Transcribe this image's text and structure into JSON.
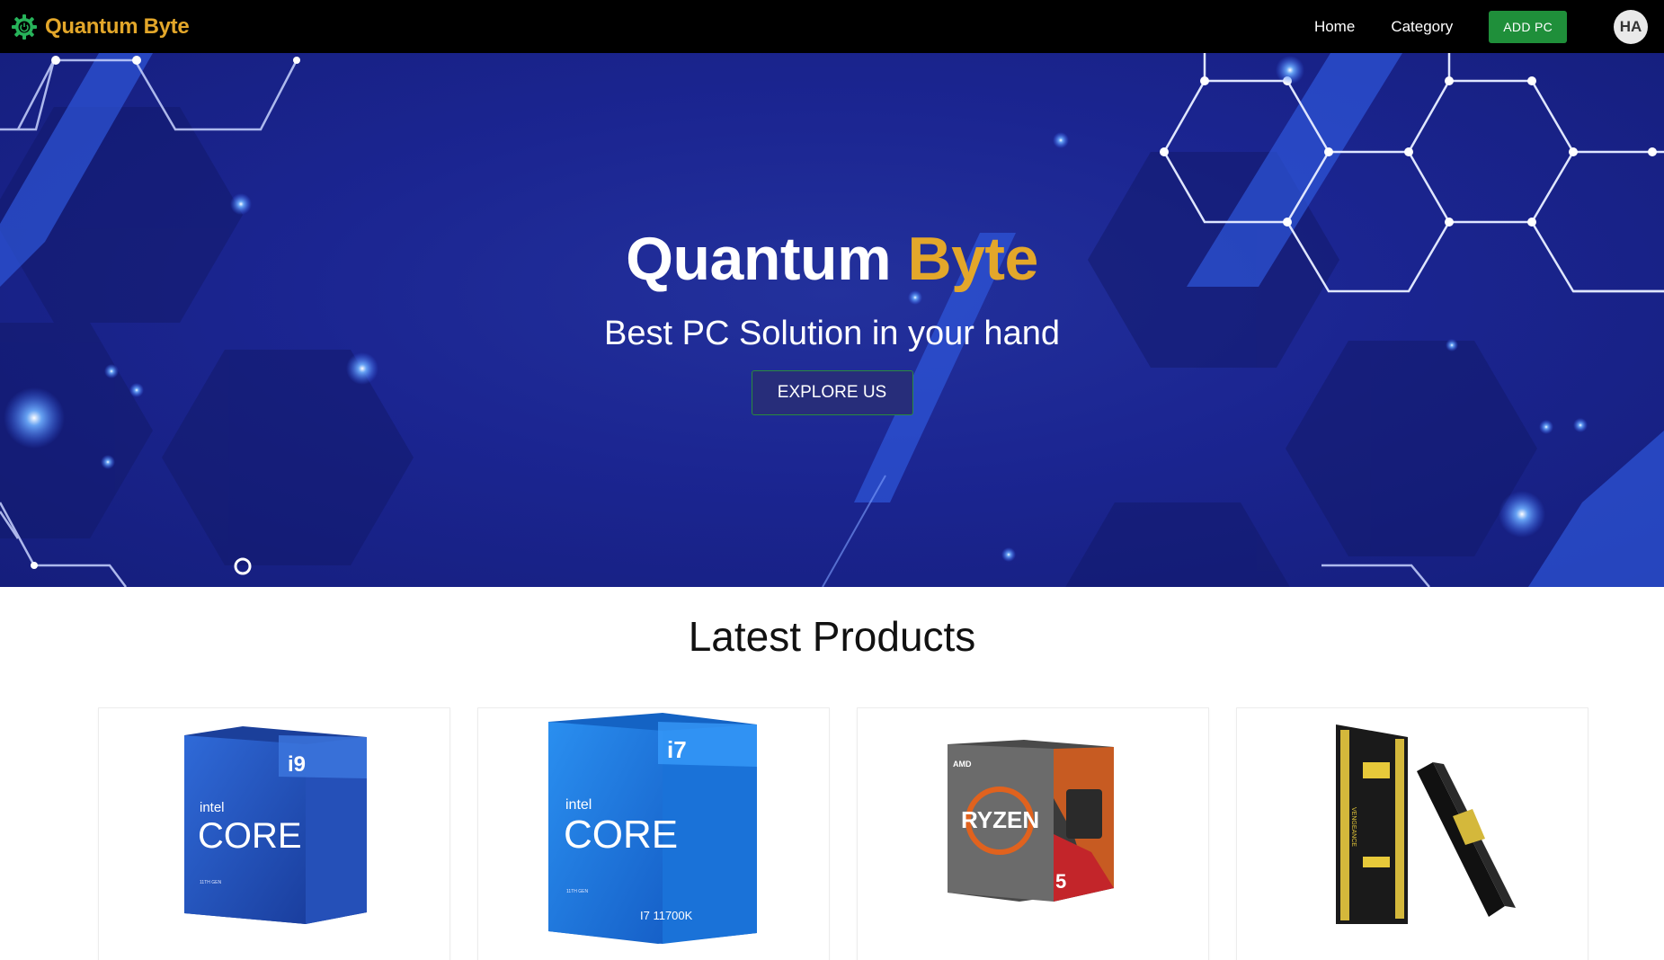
{
  "navbar": {
    "brand": "Quantum Byte",
    "links": [
      "Home",
      "Category"
    ],
    "add_button": "ADD PC",
    "avatar_initials": "HA"
  },
  "hero": {
    "title_part1": "Quantum",
    "title_part2": "Byte",
    "subtitle": "Best PC Solution in your hand",
    "cta": "EXPLORE US"
  },
  "section": {
    "title": "Latest Products"
  },
  "products": [
    {
      "image": "intel-core-i9-box",
      "badge": "i9",
      "brand": "intel",
      "line": "CORE",
      "gen": "11TH GEN"
    },
    {
      "image": "intel-core-i7-box",
      "badge": "i7",
      "brand": "intel",
      "line": "CORE",
      "gen": "11TH GEN",
      "model": "I7 11700K"
    },
    {
      "image": "amd-ryzen-5-box",
      "badge": "AMD",
      "line": "RYZEN",
      "tier": "5"
    },
    {
      "image": "corsair-vengeance-ram",
      "line": "VENGEANCE"
    }
  ],
  "colors": {
    "brand_accent": "#e3a72a",
    "add_button": "#1f8f3a",
    "hero_bg": "#1b2591",
    "cta_bg": "#272d7a"
  }
}
